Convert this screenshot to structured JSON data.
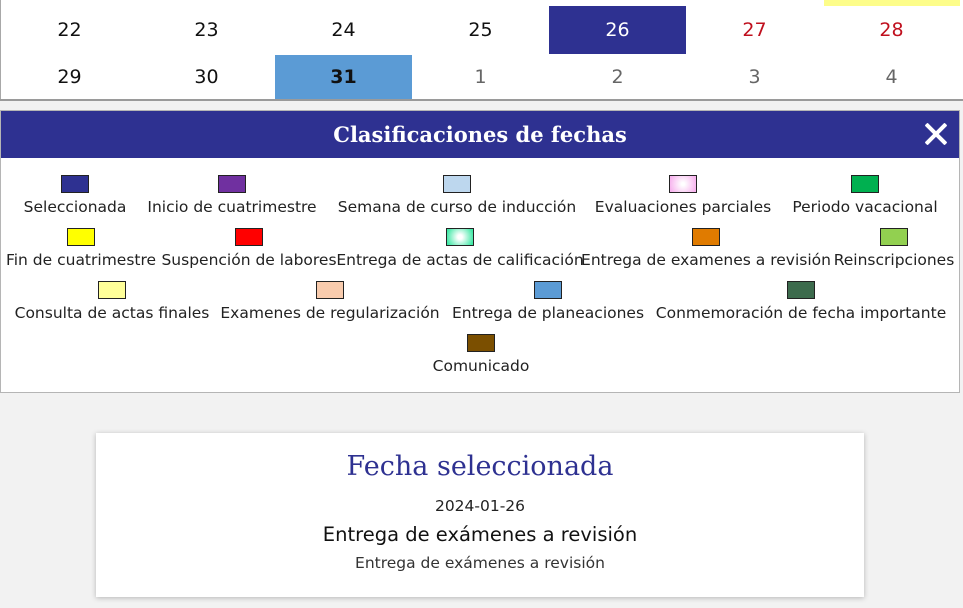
{
  "calendar": {
    "rows": [
      [
        {
          "day": "22",
          "kind": "normal"
        },
        {
          "day": "23",
          "kind": "normal"
        },
        {
          "day": "24",
          "kind": "normal"
        },
        {
          "day": "25",
          "kind": "normal"
        },
        {
          "day": "26",
          "kind": "selected"
        },
        {
          "day": "27",
          "kind": "weekend"
        },
        {
          "day": "28",
          "kind": "weekend"
        }
      ],
      [
        {
          "day": "29",
          "kind": "normal"
        },
        {
          "day": "30",
          "kind": "normal"
        },
        {
          "day": "31",
          "kind": "planeacion"
        },
        {
          "day": "1",
          "kind": "other"
        },
        {
          "day": "2",
          "kind": "other"
        },
        {
          "day": "3",
          "kind": "other"
        },
        {
          "day": "4",
          "kind": "other"
        }
      ]
    ]
  },
  "legend": {
    "title": "Clasificaciones de fechas",
    "close_icon": "close-icon",
    "items": [
      {
        "label": "Seleccionada",
        "color": "#2e3191"
      },
      {
        "label": "Inicio de cuatrimestre",
        "color": "#7030a0"
      },
      {
        "label": "Semana de curso de inducción",
        "color": "#bdd7ee"
      },
      {
        "label": "Evaluaciones parciales",
        "color": "#fbd0f5"
      },
      {
        "label": "Periodo vacacional",
        "color": "#00b050"
      },
      {
        "label": "Fin de cuatrimestre",
        "color": "#ffff00"
      },
      {
        "label": "Suspención de labores",
        "color": "#ff0000"
      },
      {
        "label": "Entrega de actas de calificación",
        "color": "#7ff5c7"
      },
      {
        "label": "Entrega de examenes a revisión",
        "color": "#e07b00"
      },
      {
        "label": "Reinscripciones",
        "color": "#92d050"
      },
      {
        "label": "Consulta de actas finales",
        "color": "#ffff99"
      },
      {
        "label": "Examenes de regularización",
        "color": "#f8cbad"
      },
      {
        "label": "Entrega de planeaciones",
        "color": "#5b9bd5"
      },
      {
        "label": "Conmemoración de fecha importante",
        "color": "#3d6b4d"
      },
      {
        "label": "Comunicado",
        "color": "#7b4f00"
      }
    ]
  },
  "selected_date": {
    "title": "Fecha seleccionada",
    "date": "2024-01-26",
    "event": "Entrega de exámenes a revisión",
    "description": "Entrega de exámenes a revisión"
  }
}
